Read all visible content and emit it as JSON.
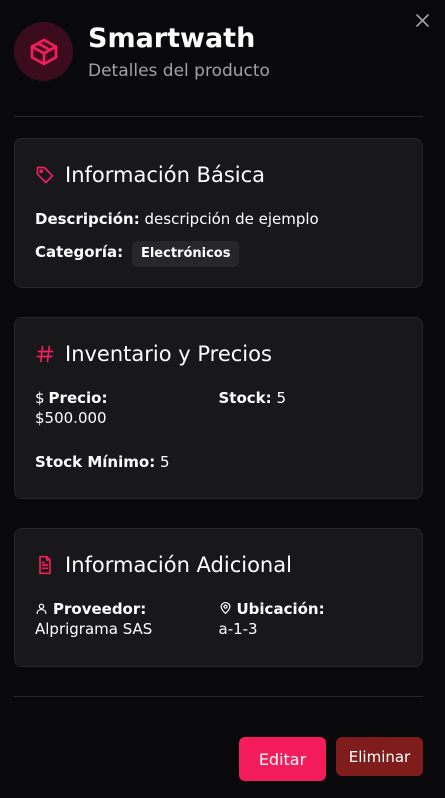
{
  "window": {
    "close_icon": "close-icon"
  },
  "header": {
    "title": "Smartwath",
    "subtitle": "Detalles del producto",
    "icon": "package-icon",
    "accent": "#f41c5b"
  },
  "basic_info": {
    "title": "Información Básica",
    "icon": "tag-icon",
    "description_label": "Descripción:",
    "description_value": "descripción de ejemplo",
    "category_label": "Categoría:",
    "category_value": "Electrónicos"
  },
  "inventory": {
    "title": "Inventario y Precios",
    "icon": "hash-icon",
    "price_symbol": "$",
    "price_label": "Precio:",
    "price_value": "$500.000",
    "stock_label": "Stock:",
    "stock_value": "5",
    "min_stock_label": "Stock Mínimo:",
    "min_stock_value": "5"
  },
  "additional": {
    "title": "Información Adicional",
    "icon": "file-text-icon",
    "supplier_label": "Proveedor:",
    "supplier_value": "Alprigrama SAS",
    "location_label": "Ubicación:",
    "location_value": "a-1-3"
  },
  "actions": {
    "edit_label": "Editar",
    "delete_label": "Eliminar",
    "edit_color": "#f41c5b",
    "delete_color": "#7f1d1d"
  }
}
